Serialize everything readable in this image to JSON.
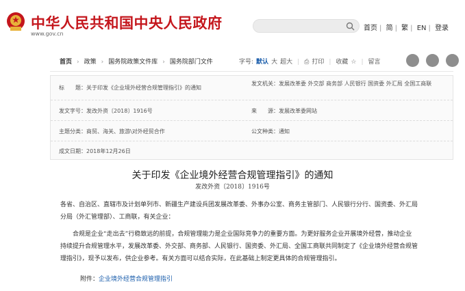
{
  "header": {
    "site_title": "中华人民共和国中央人民政府",
    "site_url": "www.gov.cn",
    "links": [
      "首页",
      "简",
      "繁",
      "EN",
      "登录"
    ]
  },
  "crumbs": [
    "首页",
    "政策",
    "国务院政策文件库",
    "国务院部门文件"
  ],
  "tools": {
    "font_label": "字号:",
    "font_default": "默认",
    "font_large": "大",
    "font_xlarge": "超大",
    "print": "打印",
    "favorite": "收藏",
    "comment": "留言"
  },
  "info": {
    "title_key": "标　　题：",
    "title_val": "关于印发《企业境外经营合规管理指引》的通知",
    "issuer_key": "发文机关：",
    "issuer_val": "发展改革委 外交部 商务部 人民银行 国资委 外汇局 全国工商联",
    "docno_key": "发文字号：",
    "docno_val": "发改外资〔2018〕1916号",
    "source_key": "来　　源：",
    "source_val": "发展改革委网站",
    "topic_key": "主题分类：",
    "topic_val": "商贸、海关、旅游\\对外经贸合作",
    "type_key": "公文种类：",
    "type_val": "通知",
    "date_key": "成文日期：",
    "date_val": "2018年12月26日"
  },
  "article": {
    "title": "关于印发《企业境外经营合规管理指引》的通知",
    "doc_no": "发改外资〔2018〕1916号",
    "para1_line1": "各省、自治区、直辖市及计划单列市、新疆生产建设兵团发展改革委、外事办公室、商务主管部门、人民银行分行、国资委、外汇局",
    "para1_line2": "分局（外汇管理部）、工商联，有关企业：",
    "para2_line1": "合规是企业“走出去”行稳致远的前提，合规管理能力是企业国际竞争力的重要方面。为更好服务企业开展境外经营，推动企业",
    "para2_line2": "持续提升合规管理水平，发展改革委、外交部、商务部、人民银行、国资委、外汇局、全国工商联共同制定了《企业境外经营合规管",
    "para2_line3": "理指引》，现予以发布，供企业参考。有关方面可以结合实际，在此基础上制定更具体的合规管理指引。",
    "attach_label": "附件：",
    "attach_link": "企业境外经营合规管理指引"
  }
}
